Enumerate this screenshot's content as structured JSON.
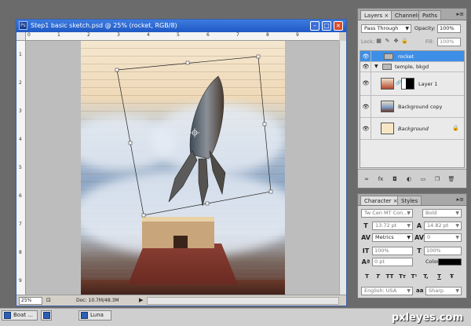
{
  "document": {
    "title": "Step1 basic sketch.psd @ 25% (rocket, RGB/8)",
    "app_icon": "Ps",
    "window_controls": [
      "–",
      "□",
      "×"
    ],
    "ruler_top_labels": [
      "0",
      "1",
      "2",
      "3",
      "4",
      "5",
      "6",
      "7",
      "8",
      "9"
    ],
    "ruler_left_labels": [
      "1",
      "2",
      "3",
      "4",
      "5",
      "6",
      "7",
      "8",
      "9"
    ],
    "zoom": "25%",
    "doc_info": "Doc: 10.7M/48.3M",
    "status_arrow": "▶"
  },
  "layers_panel": {
    "tabs": [
      "Layers ×",
      "Channels",
      "Paths"
    ],
    "menu_icon": "▸≡",
    "blend_mode": "Pass Through",
    "opacity_label": "Opacity:",
    "opacity_value": "100%",
    "lock_label": "Lock:",
    "fill_label": "Fill:",
    "fill_value": "100%",
    "layers": [
      {
        "name": "rocket",
        "type": "group",
        "selected": true
      },
      {
        "name": "temple, bkgd",
        "type": "group",
        "selected": false
      },
      {
        "name": "Layer 1",
        "type": "layer",
        "selected": false
      },
      {
        "name": "Background copy",
        "type": "layer",
        "selected": false
      },
      {
        "name": "Background",
        "type": "background",
        "selected": false
      }
    ],
    "footer_icons": [
      "link-icon",
      "fx-icon",
      "mask-icon",
      "adjustment-icon",
      "folder-icon",
      "new-layer-icon",
      "trash-icon"
    ]
  },
  "character_panel": {
    "tabs": [
      "Character ×",
      "Styles"
    ],
    "font_family": "Tw Cen MT Con...",
    "font_style": "Bold",
    "font_size": "13.72 pt",
    "leading": "14.82 pt",
    "kerning": "Metrics",
    "tracking": "0",
    "vertical_scale": "100%",
    "horizontal_scale": "100%",
    "baseline_shift": "0 pt",
    "color_label": "Color:",
    "text_color": "#000000",
    "style_buttons": [
      "T",
      "T",
      "TT",
      "Tт",
      "T¹",
      "T,",
      "T",
      "Ŧ"
    ],
    "language": "English: USA",
    "aa_label": "aa",
    "antialias": "Sharp"
  },
  "taskbar": {
    "items": [
      "Boat ...",
      "",
      "Luna"
    ]
  },
  "watermark": "pxleyes.com"
}
